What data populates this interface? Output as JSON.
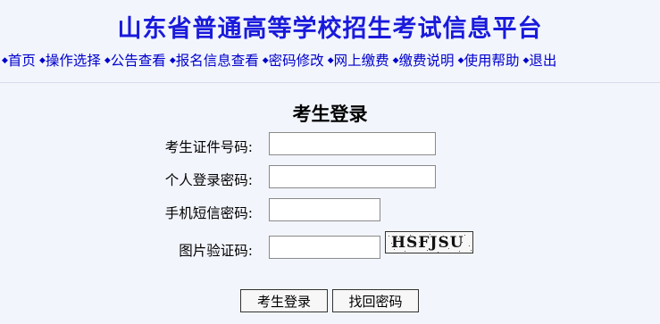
{
  "header": {
    "title": "山东省普通高等学校招生考试信息平台",
    "nav": [
      {
        "bullet": "◆",
        "label": "首页"
      },
      {
        "bullet": "◆",
        "label": "操作选择"
      },
      {
        "bullet": "◆",
        "label": "公告查看"
      },
      {
        "bullet": "◆",
        "label": "报名信息查看"
      },
      {
        "bullet": "◆",
        "label": "密码修改"
      },
      {
        "bullet": "◆",
        "label": "网上缴费"
      },
      {
        "bullet": "◆",
        "label": "缴费说明"
      },
      {
        "bullet": "◆",
        "label": "使用帮助"
      },
      {
        "bullet": "◆",
        "label": "退出"
      }
    ]
  },
  "login": {
    "title": "考生登录",
    "id_label": "考生证件号码:",
    "id_value": "",
    "password_label": "个人登录密码:",
    "password_value": "",
    "sms_label": "手机短信密码:",
    "sms_value": "",
    "captcha_label": "图片验证码:",
    "captcha_value": "",
    "captcha_text": "HSFJSU",
    "login_button": "考生登录",
    "recover_button": "找回密码"
  },
  "colors": {
    "title": "#1a1adc",
    "nav_link": "#0000cc",
    "background": "#f2f5fc"
  }
}
